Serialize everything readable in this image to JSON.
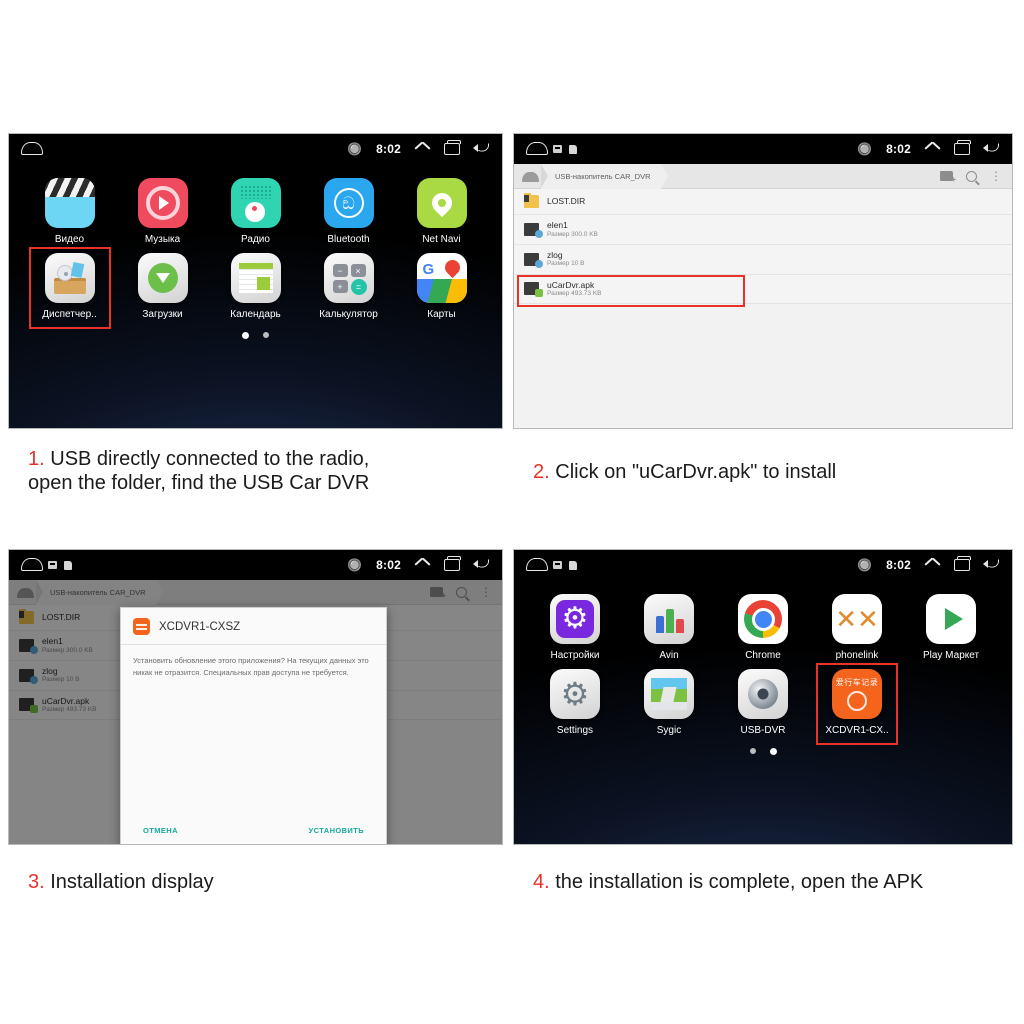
{
  "statusbar": {
    "bluetooth_icon": "bluetooth-icon",
    "time": "8:02",
    "expand_icon": "chevron-up-icon",
    "recents_icon": "recents-icon",
    "back_icon": "back-icon",
    "home_icon": "home-icon",
    "usb_icon": "usb-notification-icon",
    "storage_icon": "storage-notification-icon"
  },
  "panel1": {
    "apps_row1": [
      {
        "label": "Видео",
        "icon": "video-app-icon"
      },
      {
        "label": "Музыка",
        "icon": "music-app-icon"
      },
      {
        "label": "Радио",
        "icon": "radio-app-icon"
      },
      {
        "label": "Bluetooth",
        "icon": "bluetooth-app-icon"
      },
      {
        "label": "Net Navi",
        "icon": "net-navi-app-icon"
      }
    ],
    "apps_row2": [
      {
        "label": "Диспетчер..",
        "icon": "file-manager-app-icon",
        "selected": true
      },
      {
        "label": "Загрузки",
        "icon": "downloads-app-icon"
      },
      {
        "label": "Календарь",
        "icon": "calendar-app-icon"
      },
      {
        "label": "Калькулятор",
        "icon": "calculator-app-icon"
      },
      {
        "label": "Карты",
        "icon": "maps-app-icon"
      }
    ],
    "page_dots": 2,
    "active_dot": 0
  },
  "panel2": {
    "breadcrumb_home_icon": "home-breadcrumb-icon",
    "breadcrumb": "USB-накопитель CAR_DVR",
    "tools": {
      "new_folder_icon": "new-folder-icon",
      "search_icon": "search-icon",
      "overflow_icon": "overflow-menu-icon"
    },
    "files": [
      {
        "name": "LOST.DIR",
        "size": "",
        "type": "folder",
        "highlight": false
      },
      {
        "name": "elen1",
        "size": "Размер 300.0 KB",
        "type": "file",
        "highlight": false
      },
      {
        "name": "zlog",
        "size": "Размер 10 B",
        "type": "file",
        "highlight": false
      },
      {
        "name": "uCarDvr.apk",
        "size": "Размер 493.73 KB",
        "type": "apk",
        "highlight": true
      }
    ]
  },
  "panel3": {
    "dialog": {
      "app_icon": "xcdvr-app-icon",
      "title": "XCDVR1-CXSZ",
      "message": "Установить обновление этого приложения? На текущих данных это никак не отразится. Специальных прав доступа не требуется.",
      "cancel_label": "ОТМЕНА",
      "install_label": "УСТАНОВИТЬ"
    }
  },
  "panel4": {
    "apps_row1": [
      {
        "label": "Настройки",
        "icon": "settings-purple-app-icon"
      },
      {
        "label": "Avin",
        "icon": "avin-app-icon"
      },
      {
        "label": "Chrome",
        "icon": "chrome-app-icon"
      },
      {
        "label": "phonelink",
        "icon": "phonelink-app-icon"
      },
      {
        "label": "Play Маркет",
        "icon": "play-store-app-icon"
      }
    ],
    "apps_row2": [
      {
        "label": "Settings",
        "icon": "settings-grey-app-icon"
      },
      {
        "label": "Sygic",
        "icon": "sygic-app-icon"
      },
      {
        "label": "USB-DVR",
        "icon": "usb-dvr-app-icon"
      },
      {
        "label": "XCDVR1-CX..",
        "icon": "xcdvr-app-icon",
        "selected": true
      }
    ],
    "xcdvr_icon_text": "爱行车记录",
    "page_dots": 2,
    "active_dot": 1
  },
  "captions": {
    "c1_num": "1.",
    "c1_line1": "USB directly connected to the radio,",
    "c1_line2": "open the folder, find the USB Car DVR",
    "c2_num": "2.",
    "c2_text": "Click on \"uCarDvr.apk\" to install",
    "c3_num": "3.",
    "c3_text": "Installation display",
    "c4_num": "4.",
    "c4_text": "the installation is complete, open the APK"
  },
  "colors": {
    "highlight_red": "#e8322a",
    "caption_red": "#e8312a",
    "dialog_action_teal": "#17a99a",
    "xcdvr_orange": "#f4641d"
  }
}
